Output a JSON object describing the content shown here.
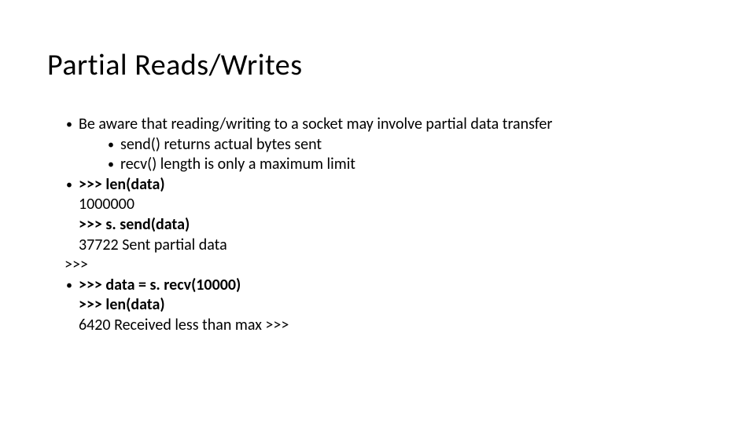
{
  "slide": {
    "title": "Partial Reads/Writes",
    "b1": "Be aware that reading/writing to a socket may involve partial data transfer",
    "b1a": "send() returns actual bytes sent",
    "b1b": "recv() length is only a maximum limit",
    "b2": ">>> len(data)",
    "b2_l2": "1000000",
    "b2_l3": ">>> s. send(data)",
    "b2_l4": "37722 Sent partial data",
    "b2_l5": ">>>",
    "b3": ">>> data = s. recv(10000)",
    "b3_l2": ">>> len(data)",
    "b3_l3": "6420 Received less than max >>>"
  }
}
